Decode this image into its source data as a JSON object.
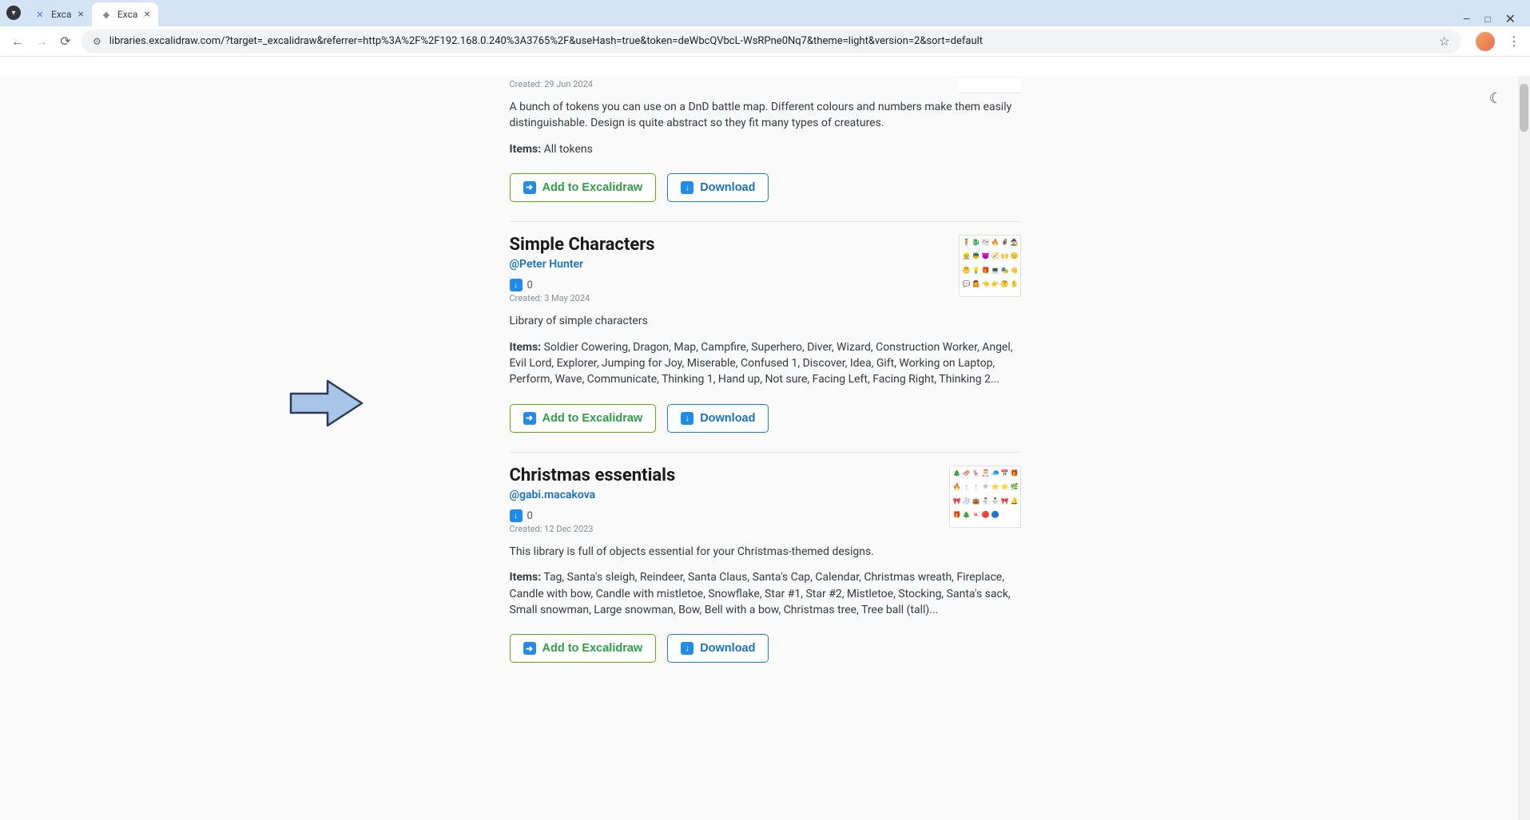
{
  "browser": {
    "tabs": [
      {
        "title": "Exca",
        "active": false
      },
      {
        "title": "Exca",
        "active": true
      }
    ],
    "url": "libraries.excalidraw.com/?target=_excalidraw&referrer=http%3A%2F%2F192.168.0.240%3A3765%2F&useHash=true&token=deWbcQVbcL-WsRPne0Nq7&theme=light&version=2&sort=default"
  },
  "buttons": {
    "add_label": "Add to Excalidraw",
    "download_label": "Download"
  },
  "libraries": [
    {
      "title": "",
      "author": "",
      "downloads": "",
      "created_label": "Created: 29 Jun 2024",
      "description": "A bunch of tokens you can use on a DnD battle map. Different colours and numbers make them easily distinguishable. Design is quite abstract so they fit many types of creatures.",
      "items_label": "Items:",
      "items_text": "All tokens"
    },
    {
      "title": "Simple Characters",
      "author": "@Peter Hunter",
      "downloads": "0",
      "created_label": "Created: 3 May 2024",
      "description": "Library of simple characters",
      "items_label": "Items:",
      "items_text": "Soldier Cowering, Dragon, Map, Campfire, Superhero, Diver, Wizard, Construction Worker, Angel, Evil Lord, Explorer, Jumping for Joy, Miserable, Confused 1, Discover, Idea, Gift, Working on Laptop, Perform, Wave, Communicate, Thinking 1, Hand up, Not sure, Facing Left, Facing Right, Thinking 2..."
    },
    {
      "title": "Christmas essentials",
      "author": "@gabi.macakova",
      "downloads": "0",
      "created_label": "Created: 12 Dec 2023",
      "description": "This library is full of objects essential for your Christmas-themed designs.",
      "items_label": "Items:",
      "items_text": "Tag, Santa's sleigh, Reindeer, Santa Claus, Santa's Cap, Calendar, Christmas wreath, Fireplace, Candle with bow, Candle with mistletoe, Snowflake, Star #1, Star #2, Mistletoe, Stocking, Santa's sack, Small snowman, Large snowman, Bow, Bell with a bow, Christmas tree, Tree ball (tall)..."
    }
  ]
}
